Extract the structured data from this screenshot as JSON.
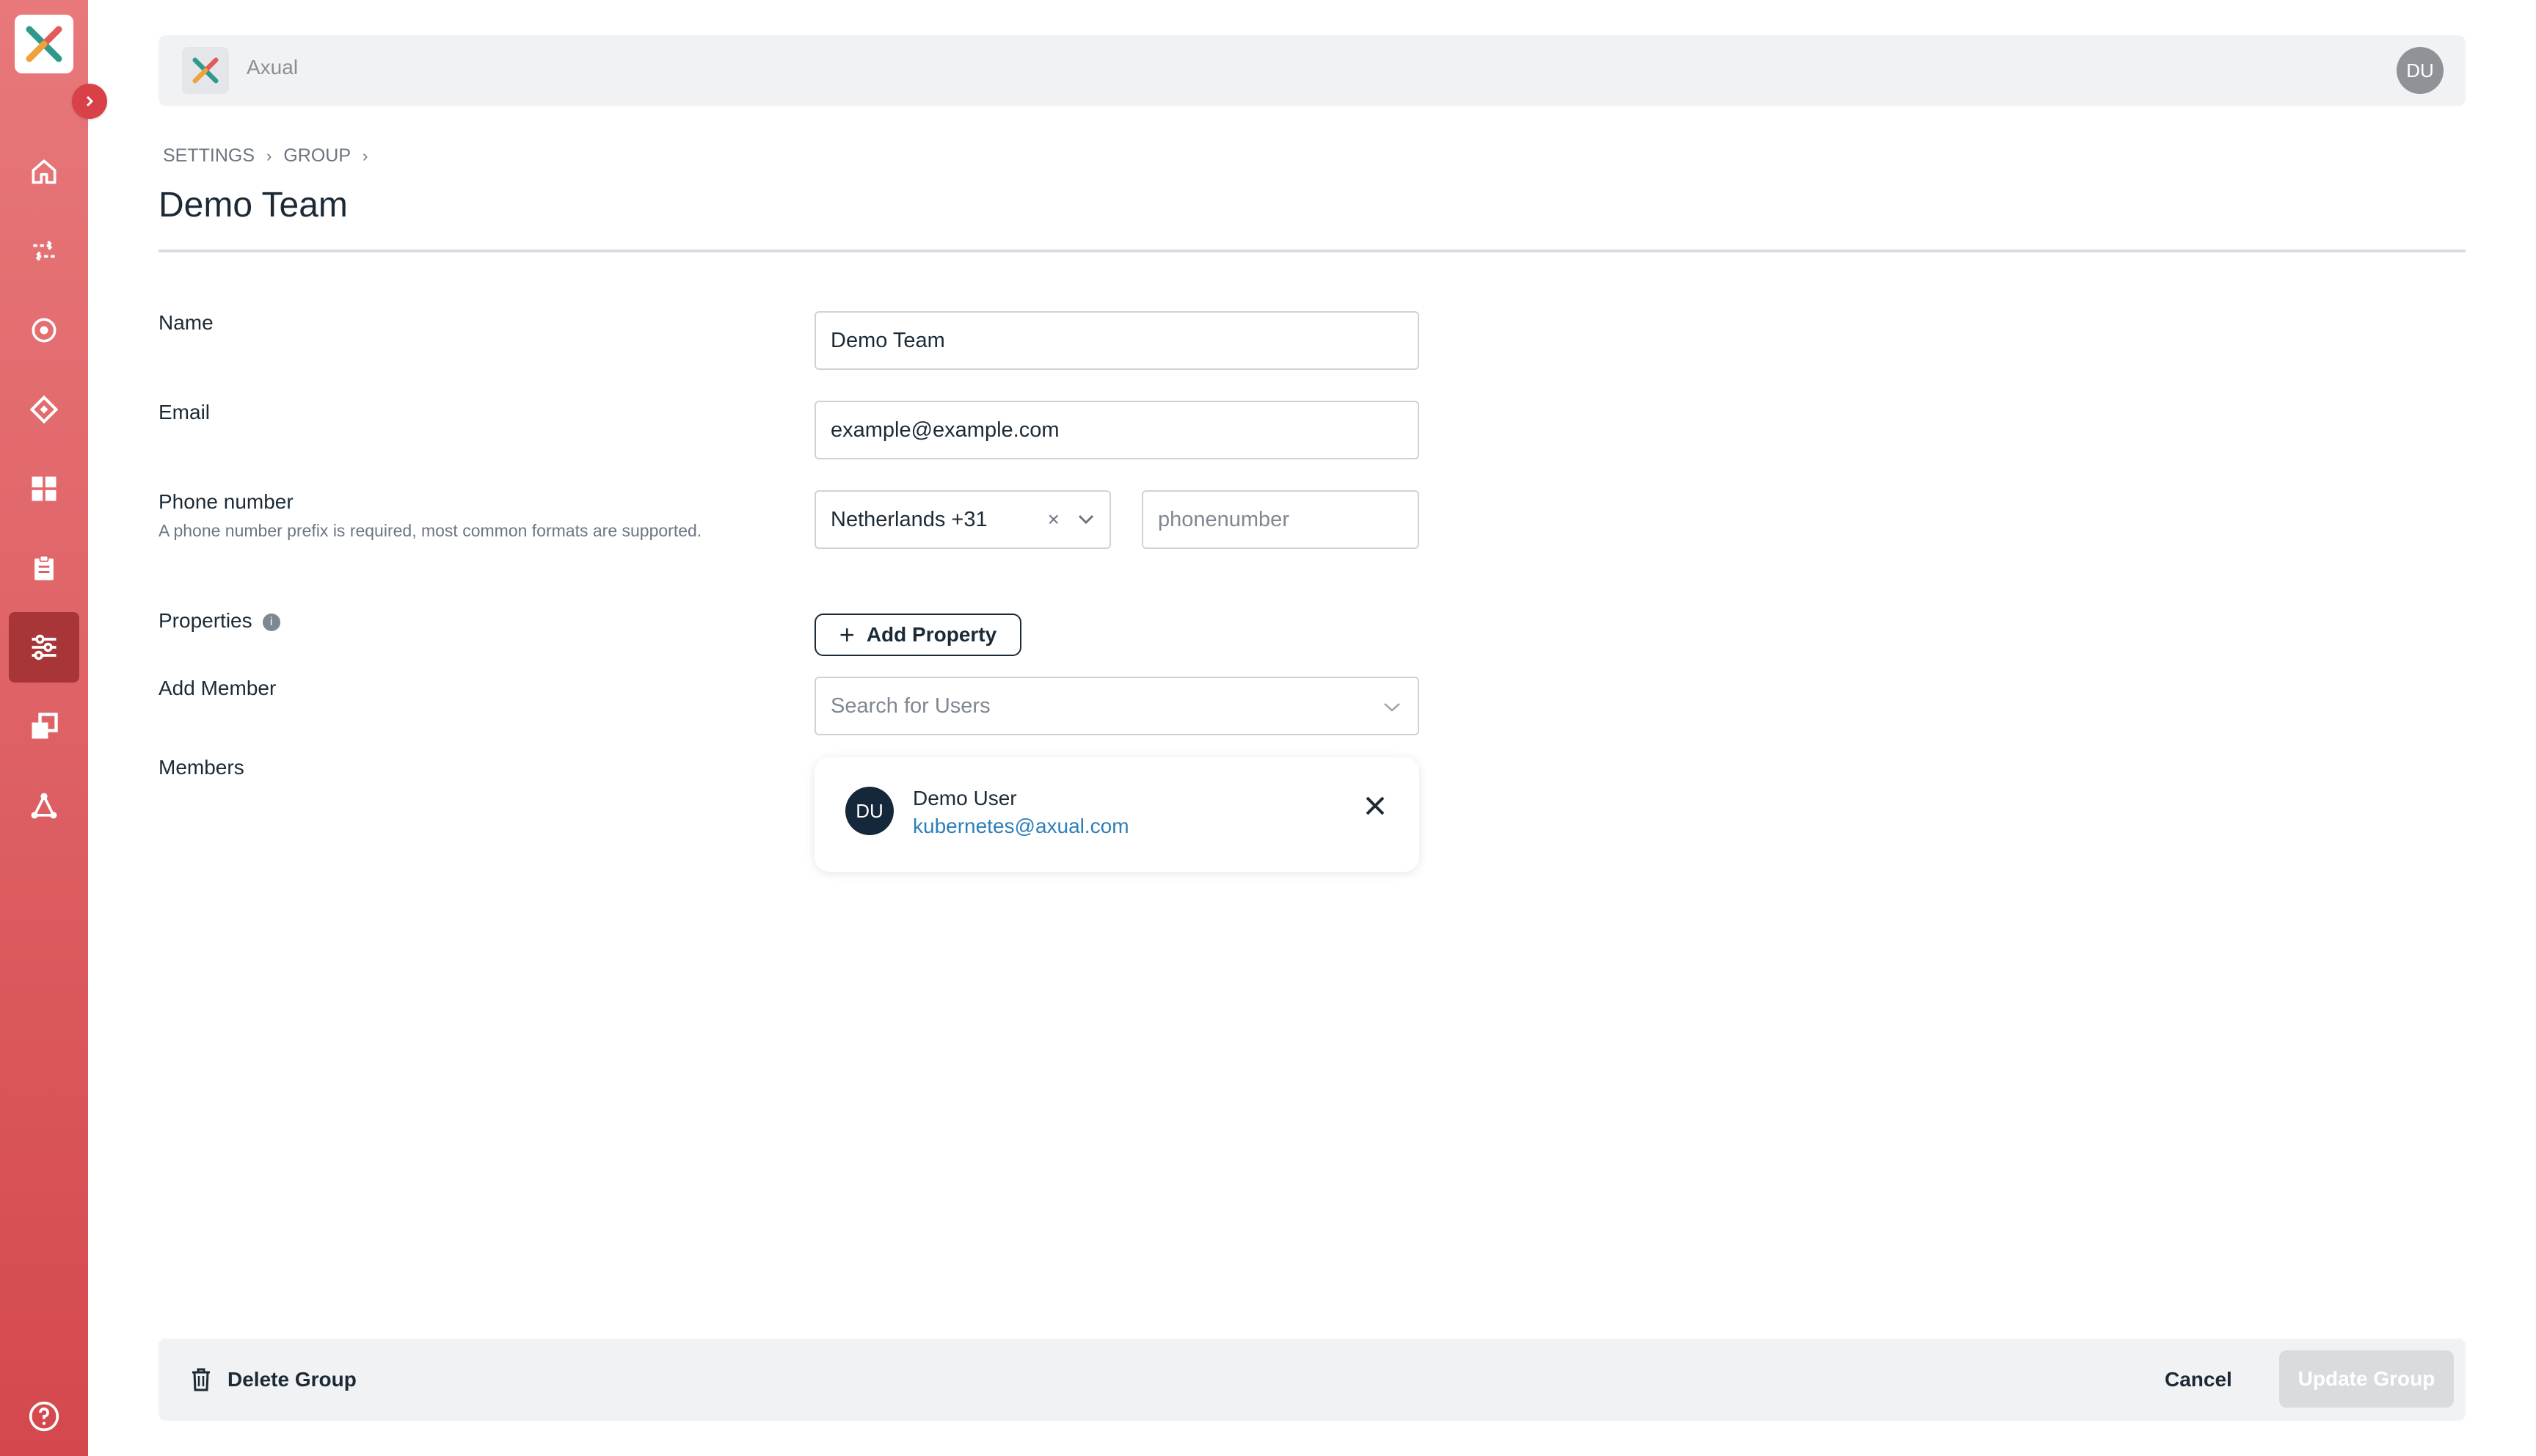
{
  "app": {
    "name": "Axual",
    "user_initials": "DU",
    "brand_color": "#dd5f63"
  },
  "sidebar": {
    "items": [
      {
        "icon": "home-icon"
      },
      {
        "icon": "streams-icon"
      },
      {
        "icon": "target-icon"
      },
      {
        "icon": "schema-icon"
      },
      {
        "icon": "dashboard-icon"
      },
      {
        "icon": "clipboard-icon"
      },
      {
        "icon": "settings-sliders-icon",
        "active": true
      },
      {
        "icon": "environments-icon"
      },
      {
        "icon": "topology-icon"
      }
    ],
    "help_icon": "help-icon"
  },
  "breadcrumb": {
    "settings": "SETTINGS",
    "group": "GROUP"
  },
  "page": {
    "title": "Demo Team"
  },
  "form": {
    "name_label": "Name",
    "name_value": "Demo Team",
    "email_label": "Email",
    "email_value": "example@example.com",
    "phone_label": "Phone number",
    "phone_helper": "A phone number prefix is required, most common formats are supported.",
    "phone_country_value": "Netherlands +31",
    "phone_placeholder": "phonenumber",
    "properties_label": "Properties",
    "add_property_label": "Add Property",
    "add_member_label": "Add Member",
    "add_member_placeholder": "Search for Users",
    "members_label": "Members"
  },
  "members": [
    {
      "initials": "DU",
      "name": "Demo User",
      "email": "kubernetes@axual.com"
    }
  ],
  "footer": {
    "delete_label": "Delete Group",
    "cancel_label": "Cancel",
    "update_label": "Update Group"
  }
}
